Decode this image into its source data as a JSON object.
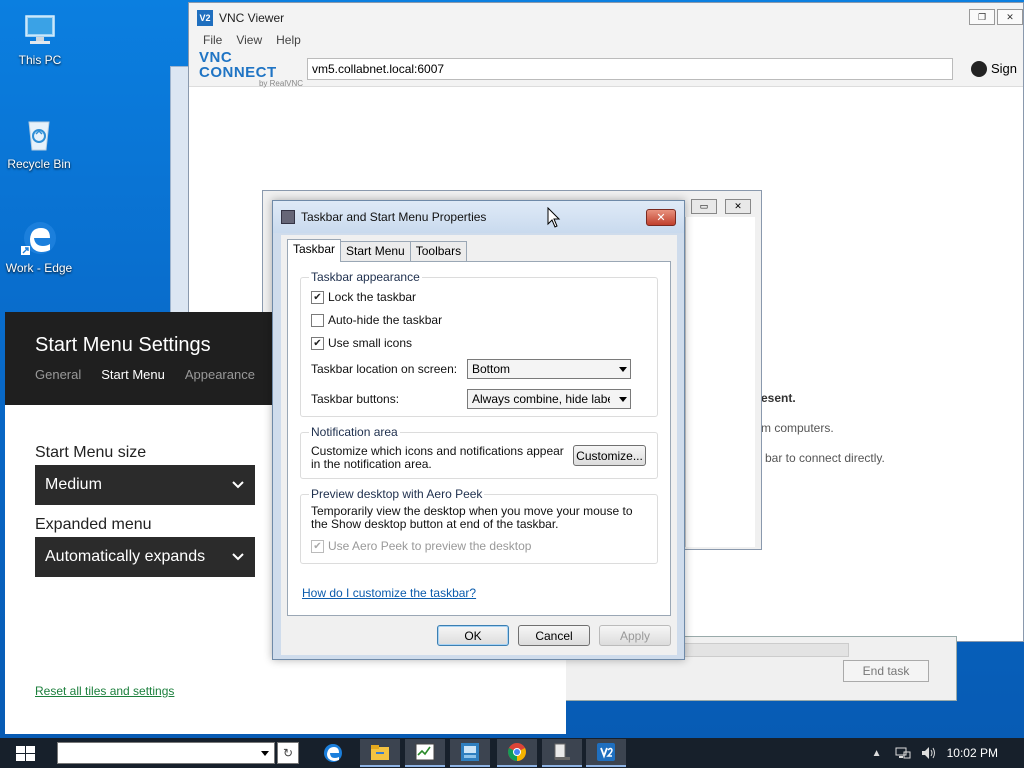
{
  "desktop": {
    "icons": [
      {
        "label": "This PC"
      },
      {
        "label": "Recycle Bin"
      },
      {
        "label": "Work - Edge"
      }
    ]
  },
  "vnc": {
    "title": "VNC Viewer",
    "menu": [
      "File",
      "View",
      "Help"
    ],
    "brand_main": "VNC CONNECT",
    "brand_sub": "by RealVNC",
    "address": "vm5.collabnet.local:6007",
    "user_label": "Sign",
    "bg_text": {
      "line1": "esent.",
      "line2": "m computers.",
      "line3": "bar to connect directly."
    },
    "logo": "V2"
  },
  "task_manager": {
    "end_task": "End task"
  },
  "start_menu_settings": {
    "title": "Start Menu Settings",
    "tabs": [
      "General",
      "Start Menu",
      "Appearance"
    ],
    "active_tab": "Start Menu",
    "size_label": "Start Menu size",
    "size_value": "Medium",
    "expanded_label": "Expanded menu",
    "expanded_value": "Automatically expands",
    "reset_link": "Reset all tiles and settings"
  },
  "dialog": {
    "title": "Taskbar and Start Menu Properties",
    "tabs": [
      "Taskbar",
      "Start Menu",
      "Toolbars"
    ],
    "active_tab": "Taskbar",
    "appearance": {
      "legend": "Taskbar appearance",
      "lock": {
        "label": "Lock the taskbar",
        "checked": true
      },
      "autohide": {
        "label": "Auto-hide the taskbar",
        "checked": false
      },
      "small_icons": {
        "label": "Use small icons",
        "checked": true
      },
      "location_label": "Taskbar location on screen:",
      "location_value": "Bottom",
      "buttons_label": "Taskbar buttons:",
      "buttons_value": "Always combine, hide labels"
    },
    "notification": {
      "legend": "Notification area",
      "text": "Customize which icons and notifications appear in the notification area.",
      "button": "Customize..."
    },
    "peek": {
      "legend": "Preview desktop with Aero Peek",
      "text": "Temporarily view the desktop when you move your mouse to the Show desktop button at end of the taskbar.",
      "checkbox": {
        "label": "Use Aero Peek to preview the desktop",
        "checked": true,
        "disabled": true
      }
    },
    "help_link": "How do I customize the taskbar?",
    "buttons": {
      "ok": "OK",
      "cancel": "Cancel",
      "apply": "Apply"
    }
  },
  "taskbar": {
    "search_value": "",
    "pinned": [
      "edge-icon",
      "file-explorer-icon",
      "task-manager-icon",
      "start-menu-tool-icon",
      "chrome-icon",
      "taskbar-properties-icon",
      "vnc-viewer-icon"
    ],
    "clock": "10:02 PM"
  },
  "colors": {
    "desktop": "#0b7fe0",
    "taskbar": "#17202b",
    "accent": "#1f74c4",
    "link_green": "#1c7f3c"
  }
}
